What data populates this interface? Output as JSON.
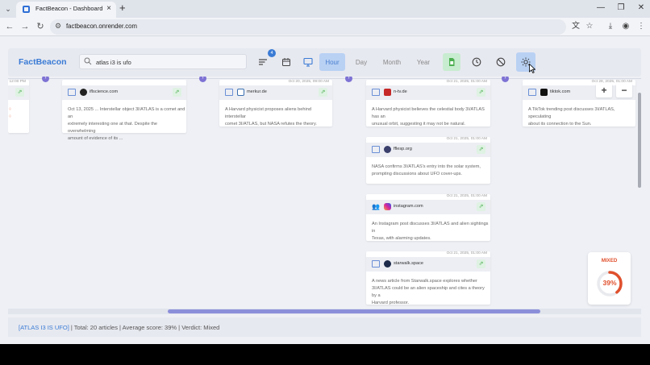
{
  "browser": {
    "tab_title": "FactBeacon - Dashboard",
    "url": "factbeacon.onrender.com",
    "tab_close": "×",
    "new_tab": "+"
  },
  "header": {
    "brand": "FactBeacon",
    "search_value": "atlas i3 is ufo",
    "filter_badge": "4",
    "granularity": [
      "Hour",
      "Day",
      "Month",
      "Year"
    ],
    "active_granularity": "Hour"
  },
  "cards": [
    {
      "id": "c0",
      "date": "12:00 PM",
      "source": "",
      "text": []
    },
    {
      "id": "c1",
      "date": "",
      "source": "iflscience.com",
      "text": [
        "Oct 13, 2025 ... Interstellar object 3I/ATLAS is a comet and an",
        "extremely interesting one at that. Despite the overwhelming",
        "amount of evidence of its ..."
      ]
    },
    {
      "id": "c2",
      "date": "Oct 20, 2025, 09:00 AM",
      "source": "merkur.de",
      "text": [
        "A Harvard physicist proposes aliens behind interstellar",
        "comet 3I/ATLAS, but NASA refutes the theory."
      ]
    },
    {
      "id": "c3",
      "date": "Oct 21, 2025, 01:00 AM",
      "source": "n-tv.de",
      "text": [
        "A Harvard physicist believes the celestial body 3I/ATLAS has an",
        "unusual orbit, suggesting it may not be natural."
      ]
    },
    {
      "id": "c4",
      "date": "Oct 21, 2025, 01:00 AM",
      "source": "fflesp.org",
      "text": [
        "NASA confirms 3I/ATLAS's entry into the solar system,",
        "prompting discussions about UFO cover-ups."
      ]
    },
    {
      "id": "c5",
      "date": "Oct 21, 2025, 01:00 AM",
      "source": "instagram.com",
      "text": [
        "An Instagram post discusses 3I/ATLAS and alien sightings in",
        "Texas, with alarming updates."
      ]
    },
    {
      "id": "c6",
      "date": "Oct 21, 2025, 01:00 AM",
      "source": "starwalk.space",
      "text": [
        "A news article from Starwalk.space explores whether",
        "3I/ATLAS could be an alien spaceship and cites a theory by a",
        "Harvard professor."
      ]
    },
    {
      "id": "c7",
      "date": "Oct 28, 2025, 01:00 AM",
      "source": "tiktok.com",
      "text": [
        "A TikTok trending post discusses 3I/ATLAS, speculating",
        "about its connection to the Sun."
      ]
    }
  ],
  "zoom": {
    "in": "+",
    "out": "−"
  },
  "score": {
    "label": "MIXED",
    "percent_text": "39%",
    "percent": 0.39,
    "color": "#e0502d"
  },
  "footer": {
    "query": "[ATLAS I3 IS UFO]",
    "summary": " | Total: 20 articles | Average score: 39% | Verdict: Mixed"
  },
  "colors": {
    "brand": "#3a7bd5",
    "active_segment_bg": "#b9d1f3",
    "timeline_marker": "#7e72d4",
    "open_link_green": "#4caf50",
    "score_ring": "#e0502d"
  }
}
